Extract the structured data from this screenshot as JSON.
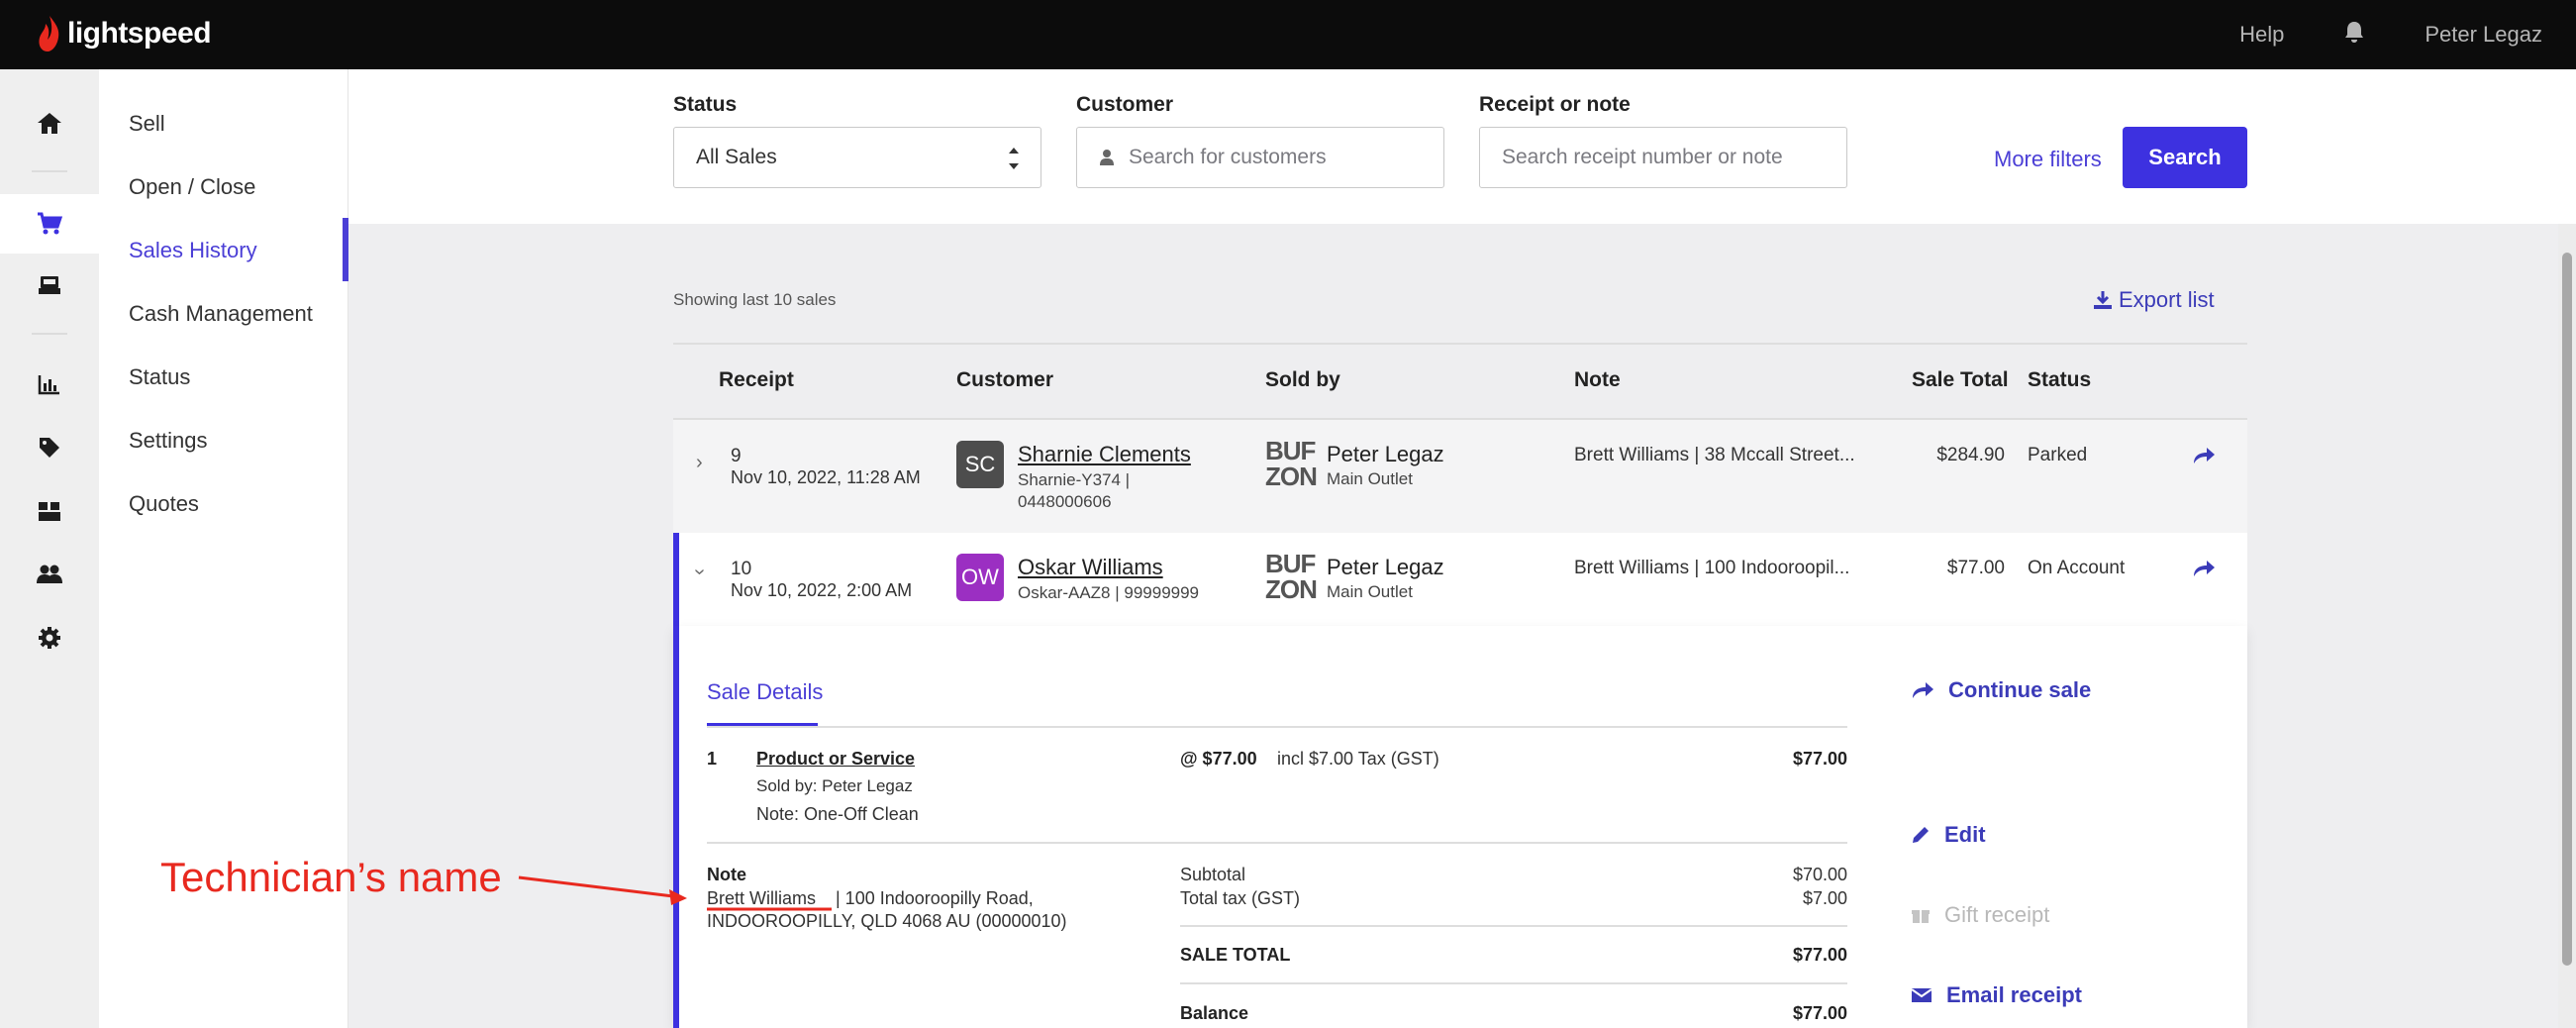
{
  "app": {
    "brand": "lightspeed",
    "accent": "#3d31e0",
    "logo_color": "#e8291f"
  },
  "topbar": {
    "help": "Help",
    "user": "Peter Legaz",
    "bell_icon": "bell-icon"
  },
  "sidebar_icons": [
    "home-icon",
    "cart-icon",
    "register-icon",
    "reports-icon",
    "tag-icon",
    "inventory-icon",
    "customers-icon",
    "settings-icon"
  ],
  "subnav": [
    "Sell",
    "Open / Close",
    "Sales History",
    "Cash Management",
    "Status",
    "Settings",
    "Quotes"
  ],
  "filters": {
    "status_label": "Status",
    "status_value": "All Sales",
    "customer_label": "Customer",
    "customer_placeholder": "Search for customers",
    "receipt_label": "Receipt or note",
    "receipt_placeholder": "Search receipt number or note",
    "more_filters": "More filters",
    "search": "Search"
  },
  "list": {
    "showing": "Showing last 10 sales",
    "export": "Export list",
    "columns": [
      "Receipt",
      "Customer",
      "Sold by",
      "Note",
      "Sale Total",
      "Status"
    ]
  },
  "rows": [
    {
      "receipt": "9",
      "date": "Nov 10, 2022, 11:28 AM",
      "initials": "SC",
      "avatar_color": "#4d4d4d",
      "customer": "Sharnie Clements",
      "customer_sub1": "Sharnie-Y374 |",
      "customer_sub2": "0448000606",
      "seller_logo_line1": "BUF",
      "seller_logo_line2": "ZON",
      "seller": "Peter Legaz",
      "outlet": "Main Outlet",
      "note": "Brett Williams | 38 Mccall Street...",
      "total": "$284.90",
      "status": "Parked"
    },
    {
      "receipt": "10",
      "date": "Nov 10, 2022, 2:00 AM",
      "initials": "OW",
      "avatar_color": "#9b2fc2",
      "customer": "Oskar Williams",
      "customer_sub1": "Oskar-AAZ8 | 99999999",
      "customer_sub2": "",
      "seller_logo_line1": "BUF",
      "seller_logo_line2": "ZON",
      "seller": "Peter Legaz",
      "outlet": "Main Outlet",
      "note": "Brett Williams | 100 Indooroopil...",
      "total": "$77.00",
      "status": "On Account"
    }
  ],
  "details": {
    "tab": "Sale Details",
    "line": {
      "qty": "1",
      "product": "Product or Service",
      "sold_by": "Sold by: Peter Legaz",
      "note": "Note: One-Off Clean",
      "unit_price": "@ $77.00",
      "tax_text": "incl $7.00 Tax (GST)",
      "amount": "$77.00"
    },
    "note_label": "Note",
    "note_name": "Brett Williams",
    "note_line1_rest": "| 100 Indooroopilly Road,",
    "note_line2": "INDOOROOPILLY, QLD 4068 AU (00000010)",
    "subtotal_label": "Subtotal",
    "subtotal": "$70.00",
    "tax_label": "Total tax (GST)",
    "tax": "$7.00",
    "sale_total_label": "SALE TOTAL",
    "sale_total": "$77.00",
    "balance_label": "Balance",
    "balance": "$77.00"
  },
  "actions": {
    "continue": "Continue sale",
    "edit": "Edit",
    "gift": "Gift receipt",
    "email": "Email receipt"
  },
  "annotation": {
    "text": "Technician’s name",
    "color": "#e8291f"
  }
}
